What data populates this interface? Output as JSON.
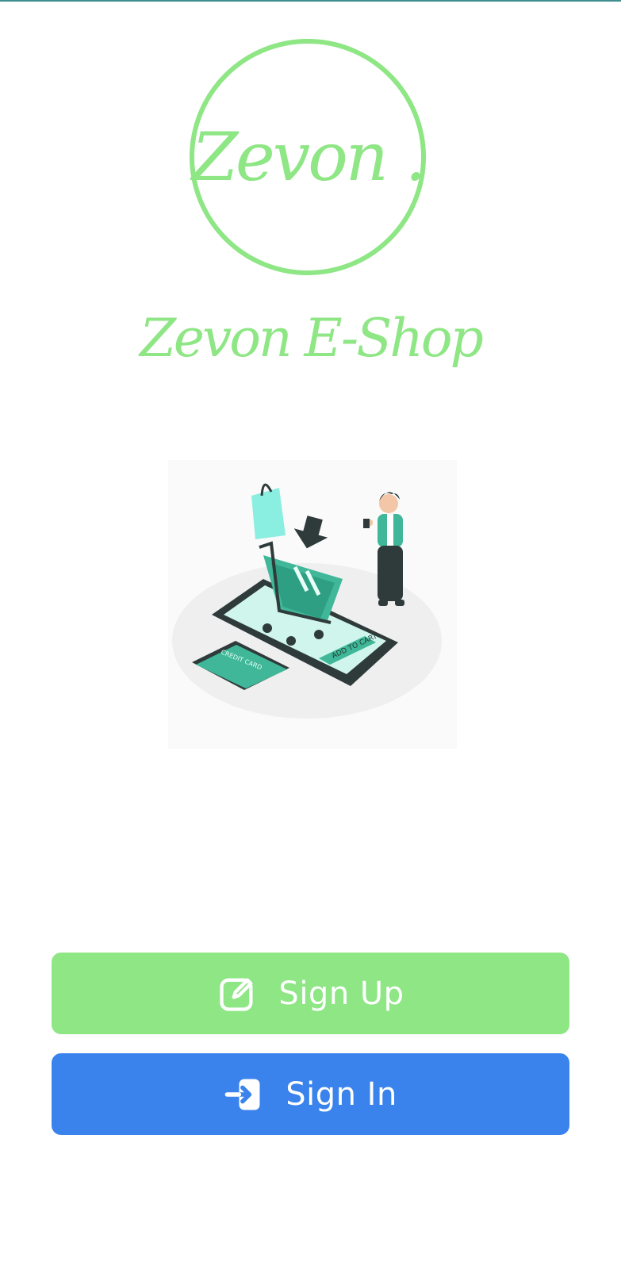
{
  "logo": {
    "text": "Zevon .",
    "color": "#8ee685"
  },
  "brand": {
    "name": "Zevon E-Shop"
  },
  "illustration": {
    "card_label": "CREDIT CARD",
    "button_label": "ADD TO CART"
  },
  "actions": {
    "signup_label": "Sign Up",
    "signin_label": "Sign In",
    "signup_icon": "edit-icon",
    "signin_icon": "login-icon",
    "signup_color": "#8ee685",
    "signin_color": "#3a82ec"
  }
}
